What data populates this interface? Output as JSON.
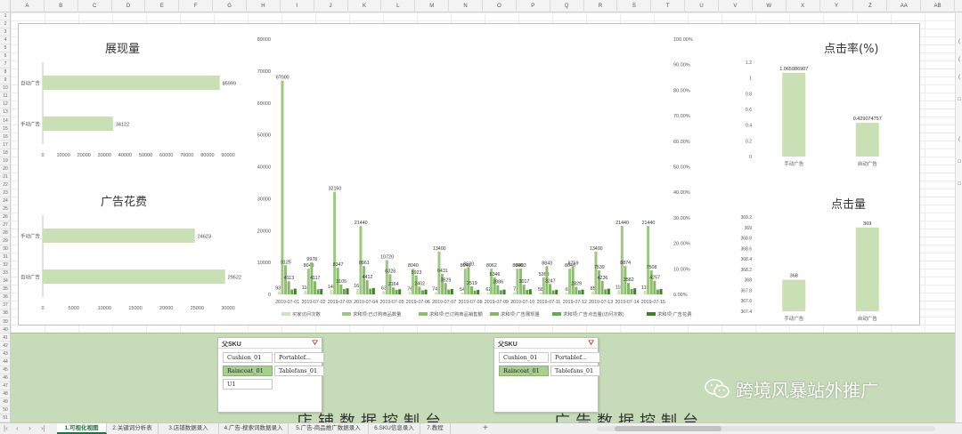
{
  "columns": [
    "A",
    "B",
    "C",
    "D",
    "E",
    "F",
    "G",
    "H",
    "I",
    "J",
    "K",
    "L",
    "M",
    "N",
    "O",
    "P",
    "Q",
    "R",
    "S",
    "T",
    "U",
    "V",
    "W",
    "X",
    "Y",
    "Z",
    "AA",
    "AB"
  ],
  "rows": [
    "1",
    "2",
    "3",
    "4",
    "5",
    "6",
    "7",
    "8",
    "9",
    "10",
    "11",
    "12",
    "13",
    "14",
    "15",
    "16",
    "17",
    "18",
    "19",
    "20",
    "21",
    "22",
    "23",
    "24",
    "25",
    "26",
    "27",
    "28",
    "29",
    "30",
    "31",
    "32",
    "33",
    "34",
    "35",
    "36",
    "37",
    "38",
    "39",
    "40",
    "41",
    "42",
    "43",
    "44",
    "45",
    "46",
    "47",
    "48",
    "49",
    "50",
    "51"
  ],
  "charts": {
    "impressions": {
      "title": "展现量"
    },
    "spend": {
      "title": "广告花费"
    },
    "ctr": {
      "title": "点击率(%)"
    },
    "clicks": {
      "title": "点击量"
    }
  },
  "chart_data": [
    {
      "type": "bar",
      "orientation": "horizontal",
      "title": "展现量",
      "categories": [
        "自动广告",
        "手动广告"
      ],
      "values": [
        85999,
        34122
      ],
      "xlim": [
        0,
        90000
      ],
      "xticks": [
        "0",
        "10000",
        "20000",
        "30000",
        "40000",
        "50000",
        "60000",
        "70000",
        "80000",
        "90000"
      ],
      "color": "#c9e0b4"
    },
    {
      "type": "bar",
      "orientation": "horizontal",
      "title": "广告花费",
      "categories": [
        "手动广告",
        "自动广告"
      ],
      "values": [
        24623,
        29522
      ],
      "xlim": [
        0,
        30000
      ],
      "xticks": [
        "0",
        "5000",
        "10000",
        "15000",
        "20000",
        "25000",
        "30000"
      ],
      "color": "#c9e0b4"
    },
    {
      "type": "bar",
      "title": "",
      "categories": [
        "2019-07-01",
        "2019-07-02",
        "2019-07-03",
        "2019-07-04",
        "2019-07-05",
        "2019-07-06",
        "2019-07-07",
        "2019-07-08",
        "2019-07-09",
        "2019-07-10",
        "2019-07-11",
        "2019-07-12",
        "2019-07-13",
        "2019-07-14",
        "2019-07-15"
      ],
      "ylim": [
        0,
        80000
      ],
      "yticks": [
        "0",
        "10000",
        "20000",
        "30000",
        "40000",
        "50000",
        "60000",
        "70000",
        "80000"
      ],
      "y2ticks": [
        "0.00%",
        "10.00%",
        "20.00%",
        "30.00%",
        "40.00%",
        "50.00%",
        "60.00%",
        "70.00%",
        "80.00%",
        "90.00%",
        "100.00%"
      ],
      "legend_position": "bottom",
      "series": [
        {
          "name": "买家访问次数",
          "color": "#cfe3bf",
          "values": [
            935,
            1100,
            1450,
            1650,
            1000,
            760,
            745,
            540,
            620,
            700,
            580,
            610,
            850,
            1300,
            1100
          ],
          "labels": [
            "935",
            "118",
            "145",
            "168",
            "63",
            "76",
            "745",
            "54",
            "62",
            "7",
            "58",
            "6",
            "85",
            "118",
            "116"
          ]
        },
        {
          "name": "求和项:已订购商品数量",
          "color": "#9cc97f",
          "values": [
            67000,
            8040,
            32160,
            21440,
            10720,
            8040,
            13400,
            8040,
            8062,
            8040,
            5360,
            8040,
            13400,
            21440,
            21440
          ],
          "labels": [
            "67000",
            "8040",
            "32160",
            "21440",
            "10720",
            "8040",
            "13400",
            "8040",
            "8062",
            "8040",
            "5360",
            "8040",
            "13400",
            "21440",
            "21440"
          ]
        },
        {
          "name": "求和项:已订购商品销售额",
          "color": "#8ebf6f",
          "values": [
            9125,
            9978,
            8347,
            8861,
            6328,
            5923,
            6431,
            8520,
            5346,
            8093,
            8843,
            8759,
            7539,
            8874,
            7508
          ],
          "labels": [
            "9125",
            "9978",
            "8347",
            "8861",
            "6328",
            "5923",
            "6431",
            "8520",
            "5346",
            "8093",
            "8843",
            "8759",
            "7539",
            "8874",
            "7508"
          ]
        },
        {
          "name": "求和项:广告展现量",
          "color": "#84b865",
          "values": [
            4113,
            4117,
            3105,
            4412,
            2164,
            2402,
            3529,
            2519,
            2886,
            3017,
            3247,
            2329,
            4236,
            3582,
            4257
          ],
          "labels": [
            "4113",
            "4117",
            "3105",
            "4412",
            "2164",
            "2402",
            "3529",
            "2519",
            "2886",
            "3017",
            "3247",
            "2329",
            "4236",
            "3582",
            "4257"
          ]
        },
        {
          "name": "求和项:广告点击量(访问次数)",
          "color": "#6aa84f",
          "values": [
            1500,
            1600,
            1700,
            1800,
            1400,
            1300,
            1500,
            1200,
            1300,
            1400,
            1250,
            1300,
            1600,
            1700,
            1500
          ],
          "labels": [
            "",
            "",
            "",
            "",
            "",
            "",
            "",
            "",
            "",
            "",
            "",
            "",
            "",
            "",
            ""
          ]
        },
        {
          "name": "求和项:广告花费",
          "color": "#3f7f2a",
          "values": [
            1800,
            1700,
            1900,
            2000,
            1600,
            1500,
            1700,
            1400,
            1500,
            1600,
            1450,
            1500,
            1800,
            1900,
            1700
          ],
          "labels": [
            "",
            "",
            "",
            "",
            "",
            "",
            "",
            "",
            "",
            "",
            "",
            "",
            "",
            "",
            ""
          ]
        }
      ]
    },
    {
      "type": "bar",
      "title": "点击率(%)",
      "categories": [
        "手动广告",
        "自动广告"
      ],
      "values": [
        1.065986907,
        0.429074757
      ],
      "ylim": [
        0,
        1.2
      ],
      "yticks": [
        "0",
        "0.2",
        "0.4",
        "0.6",
        "0.8",
        "1",
        "1.2"
      ],
      "color": "#c9e0b4"
    },
    {
      "type": "bar",
      "title": "点击量",
      "categories": [
        "手动广告",
        "自动广告"
      ],
      "values": [
        368,
        369
      ],
      "ylim": [
        367.4,
        369.2
      ],
      "yticks": [
        "367.4",
        "367.6",
        "367.8",
        "368",
        "368.2",
        "368.4",
        "368.6",
        "368.8",
        "369",
        "369.2"
      ],
      "color": "#c9e0b4"
    }
  ],
  "slicers": [
    {
      "title": "父SKU",
      "items": [
        {
          "label": "Cushion_01",
          "selected": false
        },
        {
          "label": "Portablef...",
          "selected": false
        },
        {
          "label": "Raincoat_01",
          "selected": true
        },
        {
          "label": "Tablefans_01",
          "selected": false
        },
        {
          "label": "U1",
          "selected": false
        }
      ]
    },
    {
      "title": "父SKU",
      "items": [
        {
          "label": "Cushion_01",
          "selected": false
        },
        {
          "label": "Portablef...",
          "selected": false
        },
        {
          "label": "Raincoat_01",
          "selected": true
        },
        {
          "label": "Tablefans_01",
          "selected": false
        }
      ]
    }
  ],
  "band": {
    "store_title": "店铺数据控制台",
    "ad_title": "广告数据控制台"
  },
  "watermark": {
    "text": "跨境风暴站外推广"
  },
  "tabs": [
    "1.可视化视图",
    "2.关键词分析表",
    "3.店铺数据录入",
    "4.广告-搜索词数据录入",
    "5.广告-商品推广数据录入",
    "6.SKU信息录入",
    "7.教程"
  ],
  "active_tab": 0,
  "colors": {
    "bar": "#c9e0b4",
    "accent": "#217346",
    "band": "#c6dbb7"
  }
}
